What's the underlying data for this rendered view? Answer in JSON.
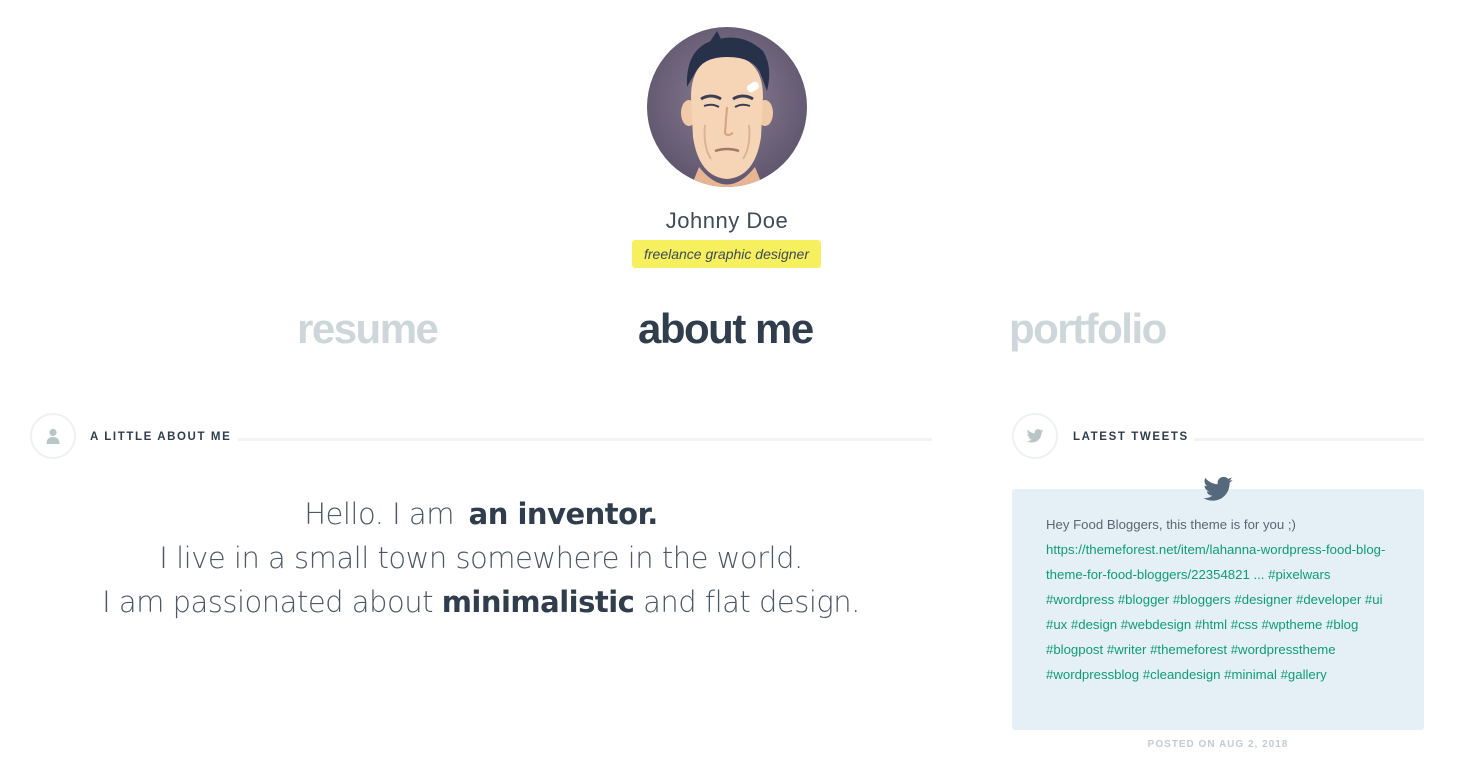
{
  "profile": {
    "name": "Johnny Doe",
    "role": "freelance graphic designer",
    "avatar_icon": "cartoon-portrait-avatar"
  },
  "nav": {
    "items": [
      {
        "label": "resume",
        "active": false
      },
      {
        "label": "about me",
        "active": true
      },
      {
        "label": "portfolio",
        "active": false
      }
    ]
  },
  "about": {
    "heading": "A LITTLE ABOUT ME",
    "icon": "user-icon",
    "intro": {
      "hello": "Hello. I am",
      "inventor": "an inventor.",
      "line2": "I live in a small town somewhere in the world.",
      "line3_start": "I am passionated about",
      "line3_bold": "minimalistic",
      "line3_end": "and flat design."
    }
  },
  "tweets": {
    "heading": "LATEST TWEETS",
    "icon": "twitter-icon",
    "tweet": {
      "text": "Hey Food Bloggers, this theme is for you ;)",
      "link": "https://themeforest.net/item/lahanna-wordpress-food-blog-theme-for-food-bloggers/22354821 ...",
      "hashtags": "#pixelwars #wordpress #blogger #bloggers #designer #developer #ui #ux #design #webdesign #html #css #wptheme #blog #blogpost #writer #themeforest #wordpresstheme #wordpressblog #cleandesign #minimal #gallery",
      "date": "POSTED ON AUG 2, 2018"
    }
  },
  "colors": {
    "accent_yellow": "#f6ef5e",
    "link_green": "#0e9c76",
    "tweet_bg": "#e4f0f6",
    "heading_dark": "#2f3d4d",
    "inactive_nav": "#cdd6d8"
  }
}
